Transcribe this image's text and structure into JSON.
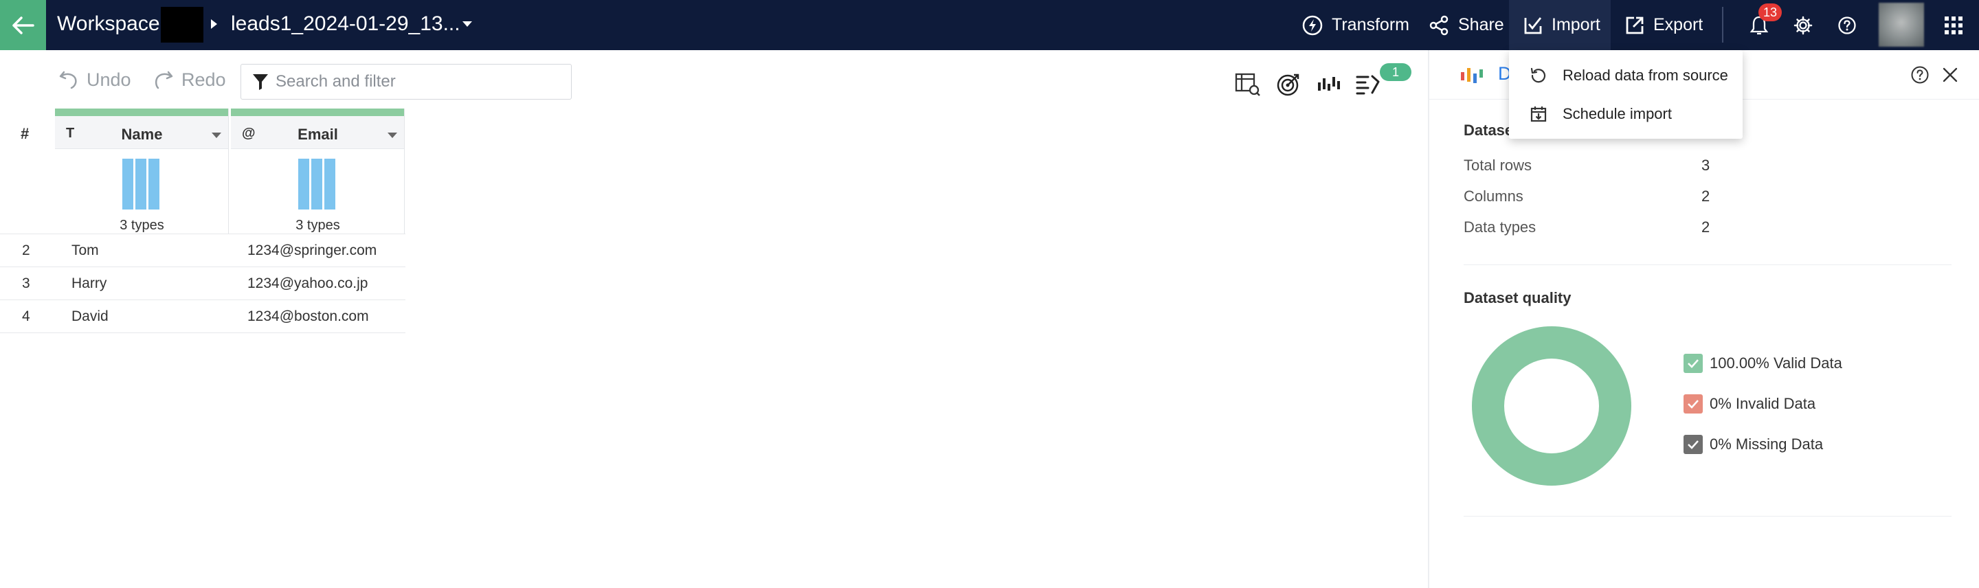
{
  "topbar": {
    "workspace_label": "Workspace",
    "dataset_name": "leads1_2024-01-29_13...",
    "actions": {
      "transform": "Transform",
      "share": "Share",
      "import": "Import",
      "export": "Export"
    },
    "notification_count": "13",
    "colors": {
      "bar_bg": "#0e1b3a",
      "back_bg": "#4caf7d"
    }
  },
  "toolbar": {
    "undo": "Undo",
    "redo": "Redo",
    "search_placeholder": "Search and filter",
    "rules_count": "1",
    "icons": [
      "data-preview-icon",
      "target-icon",
      "histogram-icon",
      "rules-icon"
    ]
  },
  "grid": {
    "row_header": "#",
    "columns": [
      {
        "type_icon": "T",
        "name": "Name",
        "profile": "3 types"
      },
      {
        "type_icon": "@",
        "name": "Email",
        "profile": "3 types"
      }
    ],
    "rows": [
      {
        "num": "2",
        "name": "Tom",
        "email": "1234@springer.com"
      },
      {
        "num": "3",
        "name": "Harry",
        "email": "1234@yahoo.co.jp"
      },
      {
        "num": "4",
        "name": "David",
        "email": "1234@boston.com"
      }
    ]
  },
  "import_menu": {
    "items": [
      {
        "label": "Reload data from source",
        "icon": "reload-icon"
      },
      {
        "label": "Schedule import",
        "icon": "calendar-download-icon"
      }
    ]
  },
  "panel": {
    "header_label": "D",
    "dataset_title": "Dataset",
    "stats": [
      {
        "label": "Total rows",
        "value": "3"
      },
      {
        "label": "Columns",
        "value": "2"
      },
      {
        "label": "Data types",
        "value": "2"
      }
    ],
    "quality_title": "Dataset quality",
    "legend": [
      {
        "label": "100.00% Valid Data",
        "color": "#86c8a2"
      },
      {
        "label": "0% Invalid Data",
        "color": "#e88c7d"
      },
      {
        "label": "0% Missing Data",
        "color": "#6e6e6e"
      }
    ]
  }
}
